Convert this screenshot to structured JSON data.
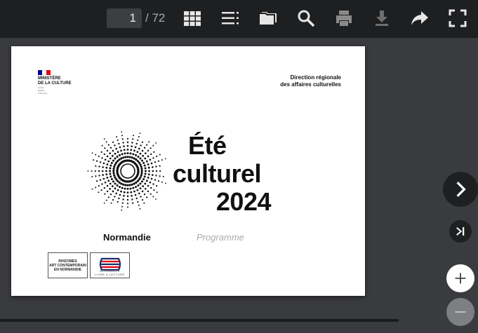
{
  "toolbar": {
    "current_page": "1",
    "page_total": "/ 72",
    "icons": [
      "thumbnails-icon",
      "outline-icon",
      "folder-icon",
      "search-icon",
      "print-icon",
      "download-icon",
      "share-icon",
      "fullscreen-icon"
    ]
  },
  "document": {
    "ministry_line1": "MINISTÈRE",
    "ministry_line2": "DE LA CULTURE",
    "motto1": "Liberté",
    "motto2": "Égalité",
    "motto3": "Fraternité",
    "direction_line1": "Direction régionale",
    "direction_line2": "des affaires culturelles",
    "title_line1": "Été",
    "title_line2": "culturel",
    "title_line3": "2024",
    "region": "Normandie",
    "programme": "Programme",
    "logo1_line1": "RHIZOMES",
    "logo1_line2": "ART CONTEMPORAIN",
    "logo1_line3": "EN NORMANDIE",
    "logo2_line1": "NORMANDIE",
    "logo2_line2": "LIVRE & LECTURE"
  },
  "colors": {
    "toolbar_bg": "#1e1f21",
    "viewer_bg": "#3a3b3e",
    "flag_blue": "#000091",
    "flag_red": "#e1000f"
  }
}
